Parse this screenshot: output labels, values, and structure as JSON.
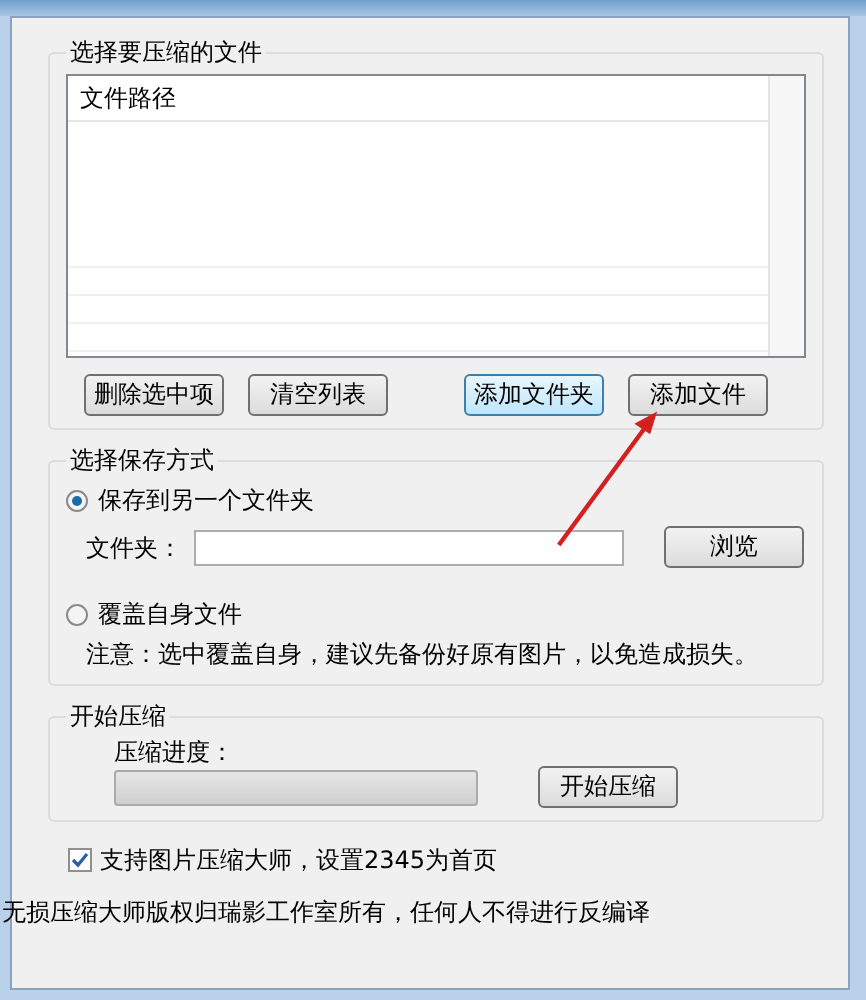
{
  "file_group": {
    "title": "选择要压缩的文件",
    "list": {
      "columns": [
        "文件路径"
      ]
    },
    "buttons": [
      "删除选中项",
      "清空列表",
      "添加文件夹",
      "添加文件"
    ]
  },
  "save_group": {
    "title": "选择保存方式",
    "options": [
      {
        "label": "保存到另一个文件夹",
        "selected": true
      },
      {
        "label": "覆盖自身文件",
        "selected": false
      }
    ],
    "folder_label": "文件夹：",
    "browse_button": "浏览",
    "note": "注意：选中覆盖自身，建议先备份好原有图片，以免造成损失。"
  },
  "compress_group": {
    "title": "开始压缩",
    "progress_label": "压缩进度：",
    "progress": {
      "level": 0
    },
    "start_button": "开始压缩"
  },
  "homepage_checkbox": {
    "label": "支持图片压缩大师，设置2345为首页",
    "checked": true
  },
  "footer": "无损压缩大师版权归瑞影工作室所有，任何人不得进行反编译"
}
